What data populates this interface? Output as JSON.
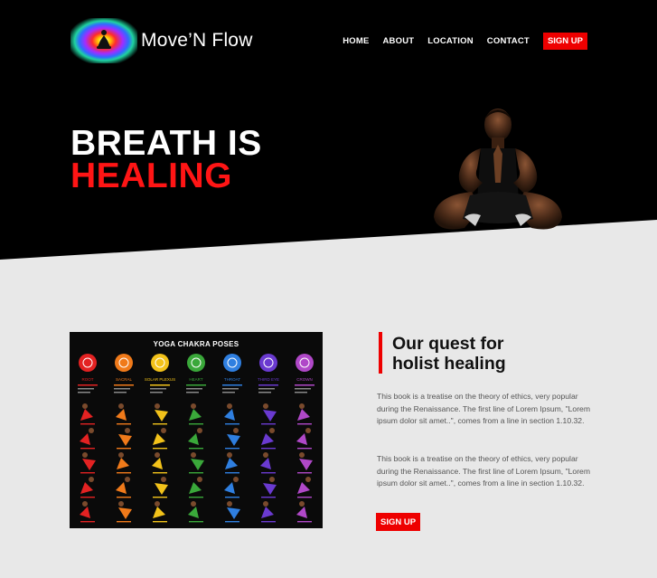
{
  "header": {
    "brand": "Move’N Flow",
    "nav": [
      "HOME",
      "ABOUT",
      "LOCATION",
      "CONTACT"
    ],
    "signup_label": "SIGN UP"
  },
  "hero": {
    "line1": "BREATH IS",
    "line2": "HEALING"
  },
  "poster": {
    "title": "YOGA CHAKRA POSES",
    "chakras": [
      {
        "name": "ROOT",
        "color": "#e32222"
      },
      {
        "name": "SACRAL",
        "color": "#f07a1a"
      },
      {
        "name": "SOLAR PLEXUS",
        "color": "#f2c21a"
      },
      {
        "name": "HEART",
        "color": "#3aa83a"
      },
      {
        "name": "THROAT",
        "color": "#2f7fe0"
      },
      {
        "name": "THIRD EYE",
        "color": "#6a3ad0"
      },
      {
        "name": "CROWN",
        "color": "#b048c8"
      }
    ]
  },
  "quest": {
    "heading_line1": "Our quest for",
    "heading_line2": "holist healing",
    "paragraph1": "This book is a treatise on the theory of ethics, very popular during the Renaissance. The first line of Lorem Ipsum, \"Lorem ipsum dolor sit amet..\", comes from a line in section 1.10.32.",
    "paragraph2": "This book is a treatise on the theory of ethics, very popular during the Renaissance. The first line of Lorem Ipsum, \"Lorem ipsum dolor sit amet..\", comes from a line in section 1.10.32.",
    "signup_label": "SIGN UP"
  },
  "colors": {
    "accent": "#ee0000",
    "hero_bg": "#000000",
    "content_bg": "#e8e8e8"
  }
}
